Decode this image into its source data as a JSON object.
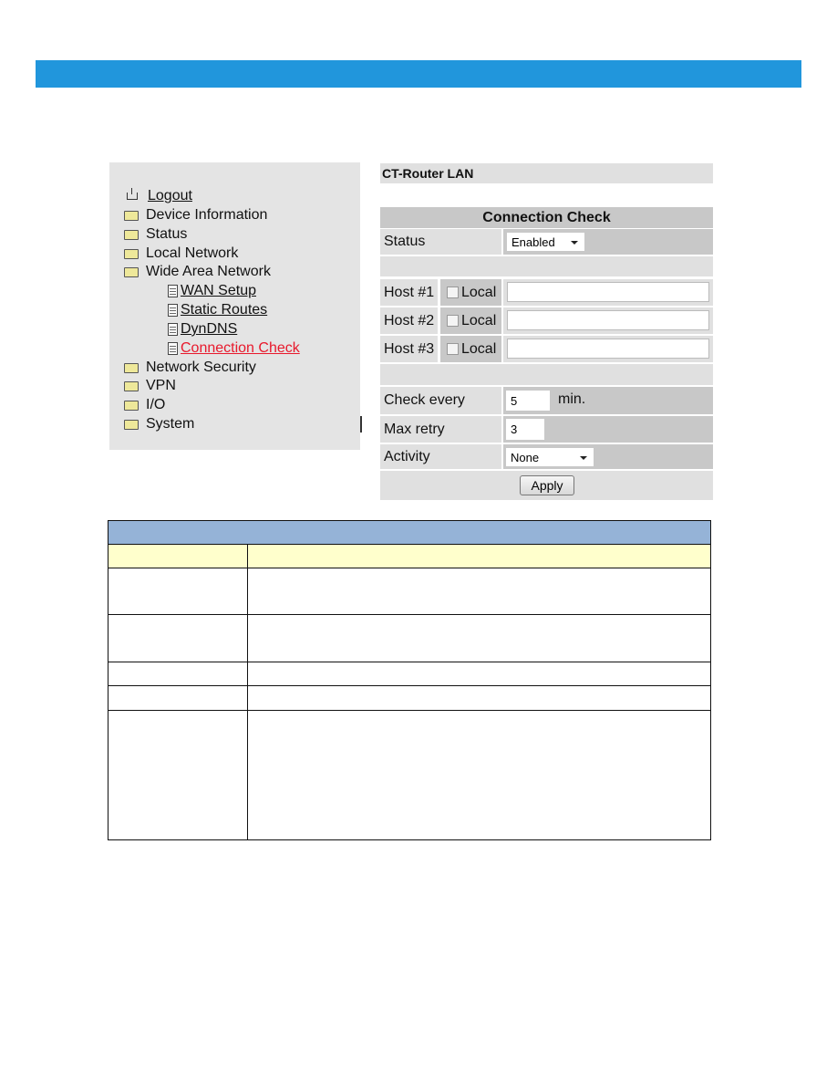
{
  "nav": {
    "logout": "Logout",
    "items": [
      "Device Information",
      "Status",
      "Local Network",
      "Wide Area Network"
    ],
    "sub_items": [
      "WAN Setup",
      "Static Routes",
      "DynDNS",
      "Connection Check"
    ],
    "items_after": [
      "Network Security",
      "VPN",
      "I/O",
      "System"
    ],
    "active": "Connection Check",
    "active_color": "#e8192c"
  },
  "panel": {
    "device_title": "CT-Router LAN",
    "section_title": "Connection Check",
    "status_label": "Status",
    "status_value": "Enabled",
    "hosts": [
      {
        "label": "Host #1",
        "local_label": "Local",
        "local_checked": false,
        "value": ""
      },
      {
        "label": "Host #2",
        "local_label": "Local",
        "local_checked": false,
        "value": ""
      },
      {
        "label": "Host #3",
        "local_label": "Local",
        "local_checked": false,
        "value": ""
      }
    ],
    "check_every_label": "Check every",
    "check_every_value": "5",
    "check_every_unit": "min.",
    "max_retry_label": "Max retry",
    "max_retry_value": "3",
    "activity_label": "Activity",
    "activity_value": "None",
    "apply_label": "Apply"
  },
  "colors": {
    "band": "#2196dc",
    "table_header": "#95b3d7",
    "table_subheader": "#ffffcc"
  }
}
